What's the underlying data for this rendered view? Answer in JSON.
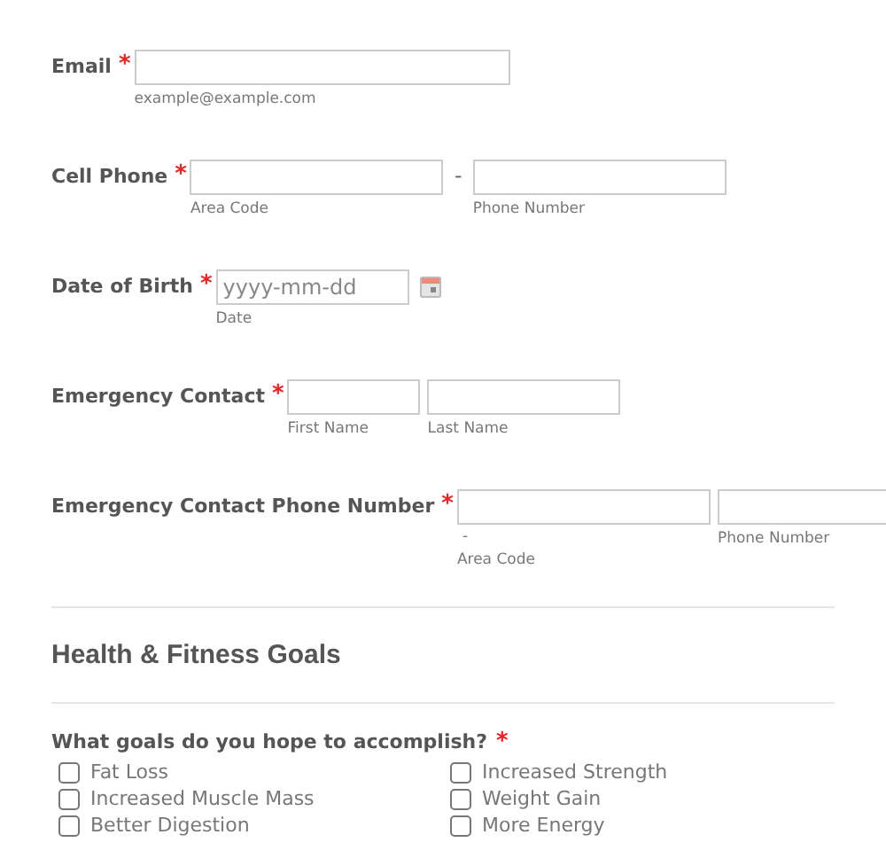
{
  "fields": [
    {
      "kind": "text",
      "label": "Email",
      "required_mark": "*",
      "inputs": [
        {
          "sublabel": "example@example.com"
        }
      ]
    },
    {
      "kind": "phone",
      "label": "Cell Phone",
      "required_mark": "*",
      "separator": "-",
      "inputs": [
        {
          "sublabel": "Area Code"
        },
        {
          "sublabel": "Phone Number"
        }
      ]
    },
    {
      "kind": "date",
      "label": "Date of Birth",
      "required_mark": "*",
      "inputs": [
        {
          "placeholder": "yyyy-mm-dd",
          "sublabel": "Date"
        }
      ]
    },
    {
      "kind": "text",
      "label": "Emergency Contact",
      "required_mark": "*",
      "inputs": [
        {
          "sublabel": "First Name"
        },
        {
          "sublabel": "Last Name"
        }
      ]
    },
    {
      "kind": "phone_stacked",
      "label": "Emergency Contact Phone Number",
      "required_mark": "*",
      "separator": "-",
      "inputs": [
        {
          "sublabel": "Area Code"
        },
        {
          "sublabel": "Phone Number"
        }
      ]
    }
  ],
  "section": {
    "title": "Health & Fitness Goals"
  },
  "question": {
    "label": "What goals do you hope to accomplish?",
    "required_mark": "*",
    "options": [
      {
        "label": "Fat Loss",
        "checked": false
      },
      {
        "label": "Increased Strength",
        "checked": false
      },
      {
        "label": "Increased Muscle Mass",
        "checked": false
      },
      {
        "label": "Weight Gain",
        "checked": false
      },
      {
        "label": "Better Digestion",
        "checked": false
      },
      {
        "label": "More Energy",
        "checked": false
      }
    ]
  }
}
